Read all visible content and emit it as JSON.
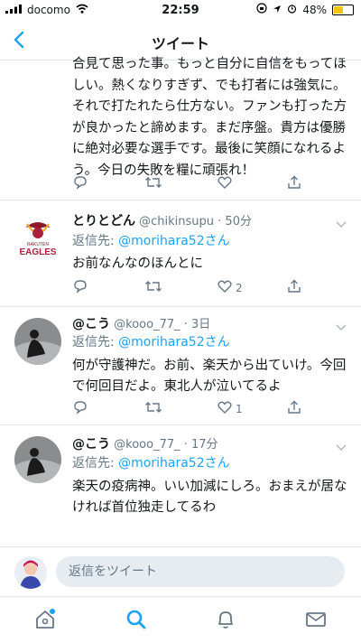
{
  "status_bar": {
    "carrier": "docomo",
    "time": "22:59",
    "battery": "48%"
  },
  "nav": {
    "title": "ツイート"
  },
  "tweets": [
    {
      "body": "合見て思った事。もっと自分に自信をもってほしい。熱くなりすぎず、でも打者には強気に。それで打たれたら仕方ない。ファンも打った方が良かったと諦めます。まだ序盤。貴方は優勝に絶対必要な選手です。最後に笑顔になれるよう。今日の失敗を糧に頑張れ！"
    },
    {
      "name": "とりとどん",
      "handle": "@chikinsupu",
      "time": "· 50分",
      "reply_prefix": "返信先: ",
      "reply_to": "@morihara52さん",
      "body": "お前なんなのほんとに",
      "likes": "2",
      "avatar_text_top": "RAKUTEN",
      "avatar_text": "EAGLES"
    },
    {
      "name": "@こう",
      "handle": "@kooo_77_",
      "time": "· 3日",
      "reply_prefix": "返信先: ",
      "reply_to": "@morihara52さん",
      "body": "何が守護神だ。お前、楽天から出ていけ。今回で何回目だよ。東北人が泣いてるよ",
      "likes": "1"
    },
    {
      "name": "@こう",
      "handle": "@kooo_77_",
      "time": "· 17分",
      "reply_prefix": "返信先: ",
      "reply_to": "@morihara52さん",
      "body": "楽天の疫病神。いい加減にしろ。おまえが居なければ首位独走してるわ"
    }
  ],
  "compose": {
    "placeholder": "返信をツイート"
  },
  "colors": {
    "accent": "#1da1f2",
    "muted": "#657786",
    "divider": "#e1e8ed"
  }
}
